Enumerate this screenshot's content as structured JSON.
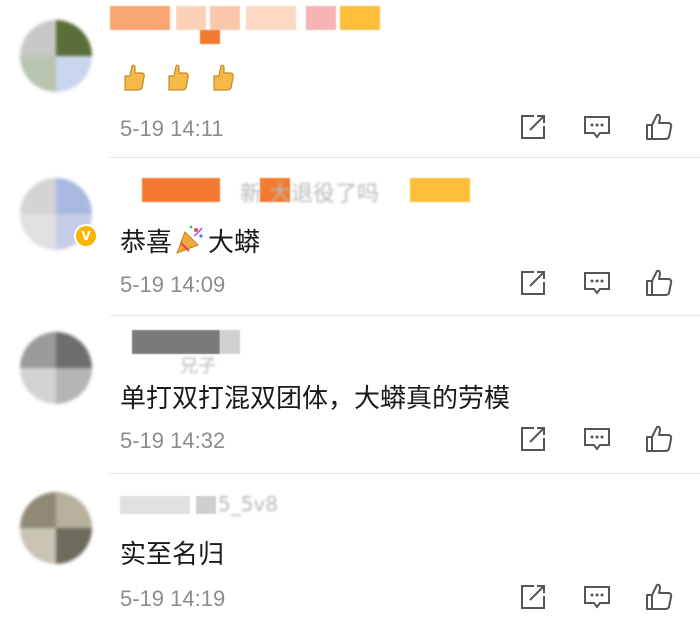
{
  "comments": [
    {
      "content_emoji": [
        "thumbs-up-emoji",
        "thumbs-up-emoji",
        "thumbs-up-emoji"
      ],
      "time": "5-19 14:11"
    },
    {
      "name_visible": "新 大退役了吗",
      "content_before": "恭喜",
      "content_emoji": "party-popper-emoji",
      "content_after": "大蟒",
      "time": "5-19 14:09",
      "verified_badge": "V"
    },
    {
      "name_visible": "兄子",
      "content": "单打双打混双团体，大蟒真的劳模",
      "time": "5-19 14:32"
    },
    {
      "name_visible": "5_5v8",
      "content": "实至名归",
      "time": "5-19 14:19"
    }
  ],
  "action_icons": [
    "share-icon",
    "comment-icon",
    "like-icon"
  ],
  "colors": {
    "text_primary": "#1a1a1a",
    "text_secondary": "#8c8c8c",
    "icon": "#555555",
    "verified": "#f7b500",
    "divider": "#e6e6e6"
  }
}
